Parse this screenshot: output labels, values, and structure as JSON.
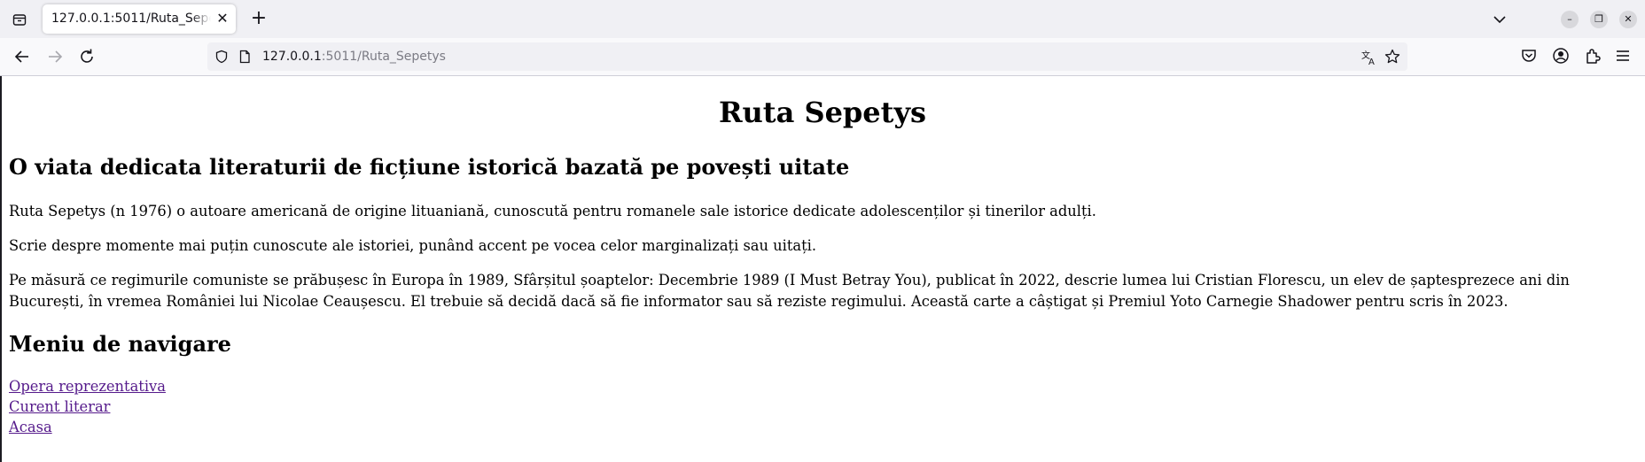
{
  "browser": {
    "tab_title": "127.0.0.1:5011/Ruta_Sepetys",
    "url_host": "127.0.0.1",
    "url_rest": ":5011/Ruta_Sepetys"
  },
  "page": {
    "title": "Ruta Sepetys",
    "subtitle": "O viata dedicata literaturii de ficțiune istorică bazată pe povești uitate",
    "paragraphs": [
      "Ruta Sepetys (n 1976) o autoare americană de origine lituaniană, cunoscută pentru romanele sale istorice dedicate adolescenților și tinerilor adulți.",
      "Scrie despre momente mai puțin cunoscute ale istoriei, punând accent pe vocea celor marginalizați sau uitați.",
      "Pe măsură ce regimurile comuniste se prăbușesc în Europa în 1989, Sfârșitul șoaptelor: Decembrie 1989 (I Must Betray You), publicat în 2022, descrie lumea lui Cristian Florescu, un elev de șaptesprezece ani din București, în vremea României lui Nicolae Ceaușescu. El trebuie să decidă dacă să fie informator sau să reziste regimului. Această carte a câștigat și Premiul Yoto Carnegie Shadower pentru scris în 2023."
    ],
    "nav_heading": "Meniu de navigare",
    "nav_links": [
      "Opera reprezentativa",
      "Curent literar",
      "Acasa"
    ]
  },
  "colors": {
    "link_visited": "#551a8b",
    "toolbar_bg": "#f9f9fb",
    "tabbar_bg": "#f0f0f4"
  }
}
